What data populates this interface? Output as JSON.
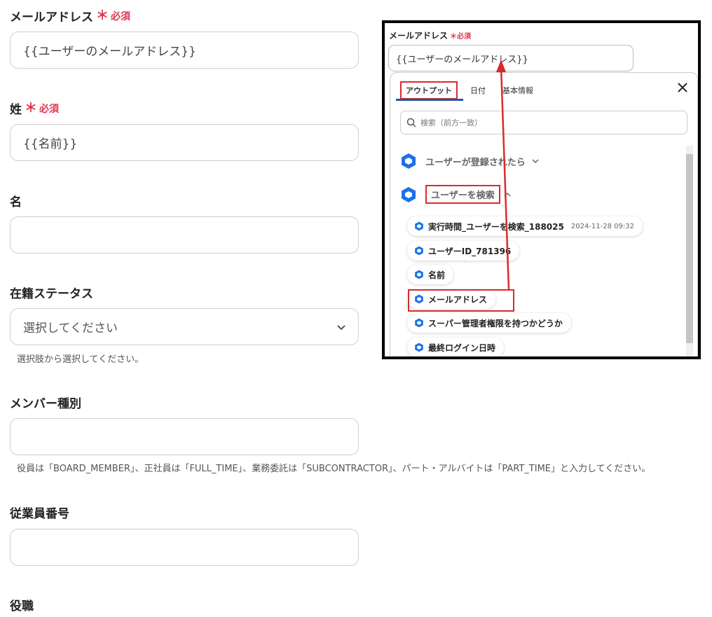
{
  "required_text": "必須",
  "form": {
    "email": {
      "label": "メールアドレス",
      "value": "{{ユーザーのメールアドレス}}"
    },
    "last_name": {
      "label": "姓",
      "value": "{{名前}}"
    },
    "first_name": {
      "label": "名",
      "value": ""
    },
    "status": {
      "label": "在籍ステータス",
      "placeholder": "選択してください",
      "help": "選択肢から選択してください。"
    },
    "member_type": {
      "label": "メンバー種別",
      "value": "",
      "help": "役員は「BOARD_MEMBER」、正社員は「FULL_TIME」、業務委託は「SUBCONTRACTOR」、パート・アルバイトは「PART_TIME」と入力してください。"
    },
    "employee_no": {
      "label": "従業員番号",
      "value": ""
    },
    "position": {
      "label": "役職"
    }
  },
  "overlay": {
    "label": "メールアドレス",
    "required": "必須",
    "input_value": "{{ユーザーのメールアドレス}}",
    "tabs": [
      "アウトプット",
      "日付",
      "基本情報"
    ],
    "search_placeholder": "検索（前方一致）",
    "groups": [
      {
        "label": "ユーザーが登録されたら",
        "expanded": false
      },
      {
        "label": "ユーザーを検索",
        "expanded": true
      }
    ],
    "items": [
      {
        "label": "実行時間_ユーザーを検索_188025",
        "timestamp": "2024-11-28 09:32"
      },
      {
        "label": "ユーザーID_781396"
      },
      {
        "label": "名前"
      },
      {
        "label": "メールアドレス"
      },
      {
        "label": "スーパー管理者権限を持つかどうか"
      },
      {
        "label": "最終ログイン日時"
      }
    ]
  },
  "colors": {
    "required": "#e0364f",
    "highlight": "#d92b2b",
    "icon": "#1a73e8",
    "tab_underline": "#1e5aa5"
  }
}
